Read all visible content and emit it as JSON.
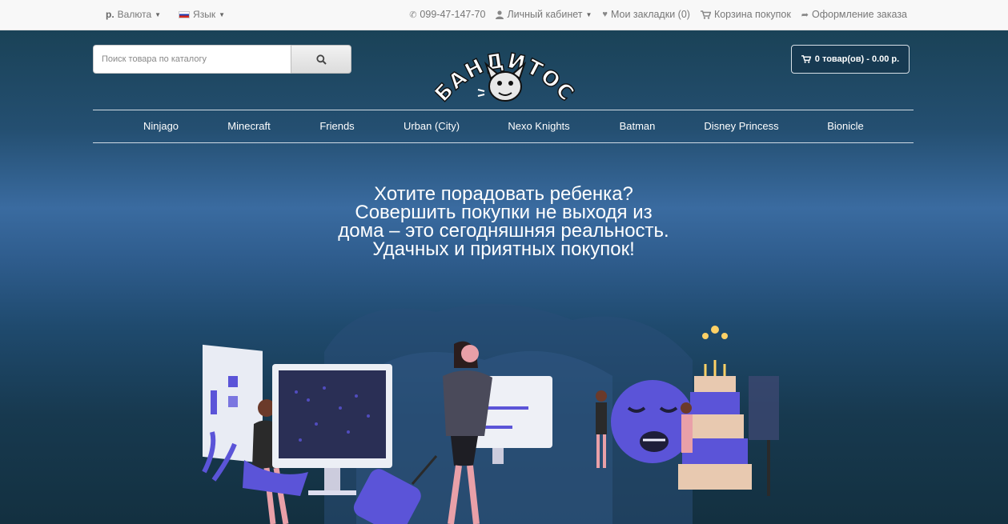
{
  "topbar": {
    "currency_symbol": "р.",
    "currency_label": "Валюта",
    "language_label": "Язык",
    "phone": "099-47-147-70",
    "account_label": "Личный кабинет",
    "wishlist_label": "Мои закладки (0)",
    "cart_label": "Корзина покупок",
    "checkout_label": "Оформление заказа"
  },
  "search": {
    "placeholder": "Поиск товара по каталогу"
  },
  "logo": {
    "text": "БАНДИТОС"
  },
  "cart": {
    "summary": "0 товар(ов) - 0.00 р."
  },
  "menu": {
    "items": [
      {
        "label": "Ninjago"
      },
      {
        "label": "Minecraft"
      },
      {
        "label": "Friends"
      },
      {
        "label": "Urban (City)"
      },
      {
        "label": "Nexo Knights"
      },
      {
        "label": "Batman"
      },
      {
        "label": "Disney Princess"
      },
      {
        "label": "Bionicle"
      }
    ]
  },
  "hero": {
    "lines": [
      "Хотите порадовать ребенка?",
      "Совершить покупки не выходя из",
      "дома – это сегодняшняя реальность.",
      "Удачных и приятных покупок!"
    ]
  },
  "colors": {
    "accent_purple": "#5b54d8",
    "hero_top": "#1a4257",
    "hero_mid": "#3a6ba0"
  }
}
